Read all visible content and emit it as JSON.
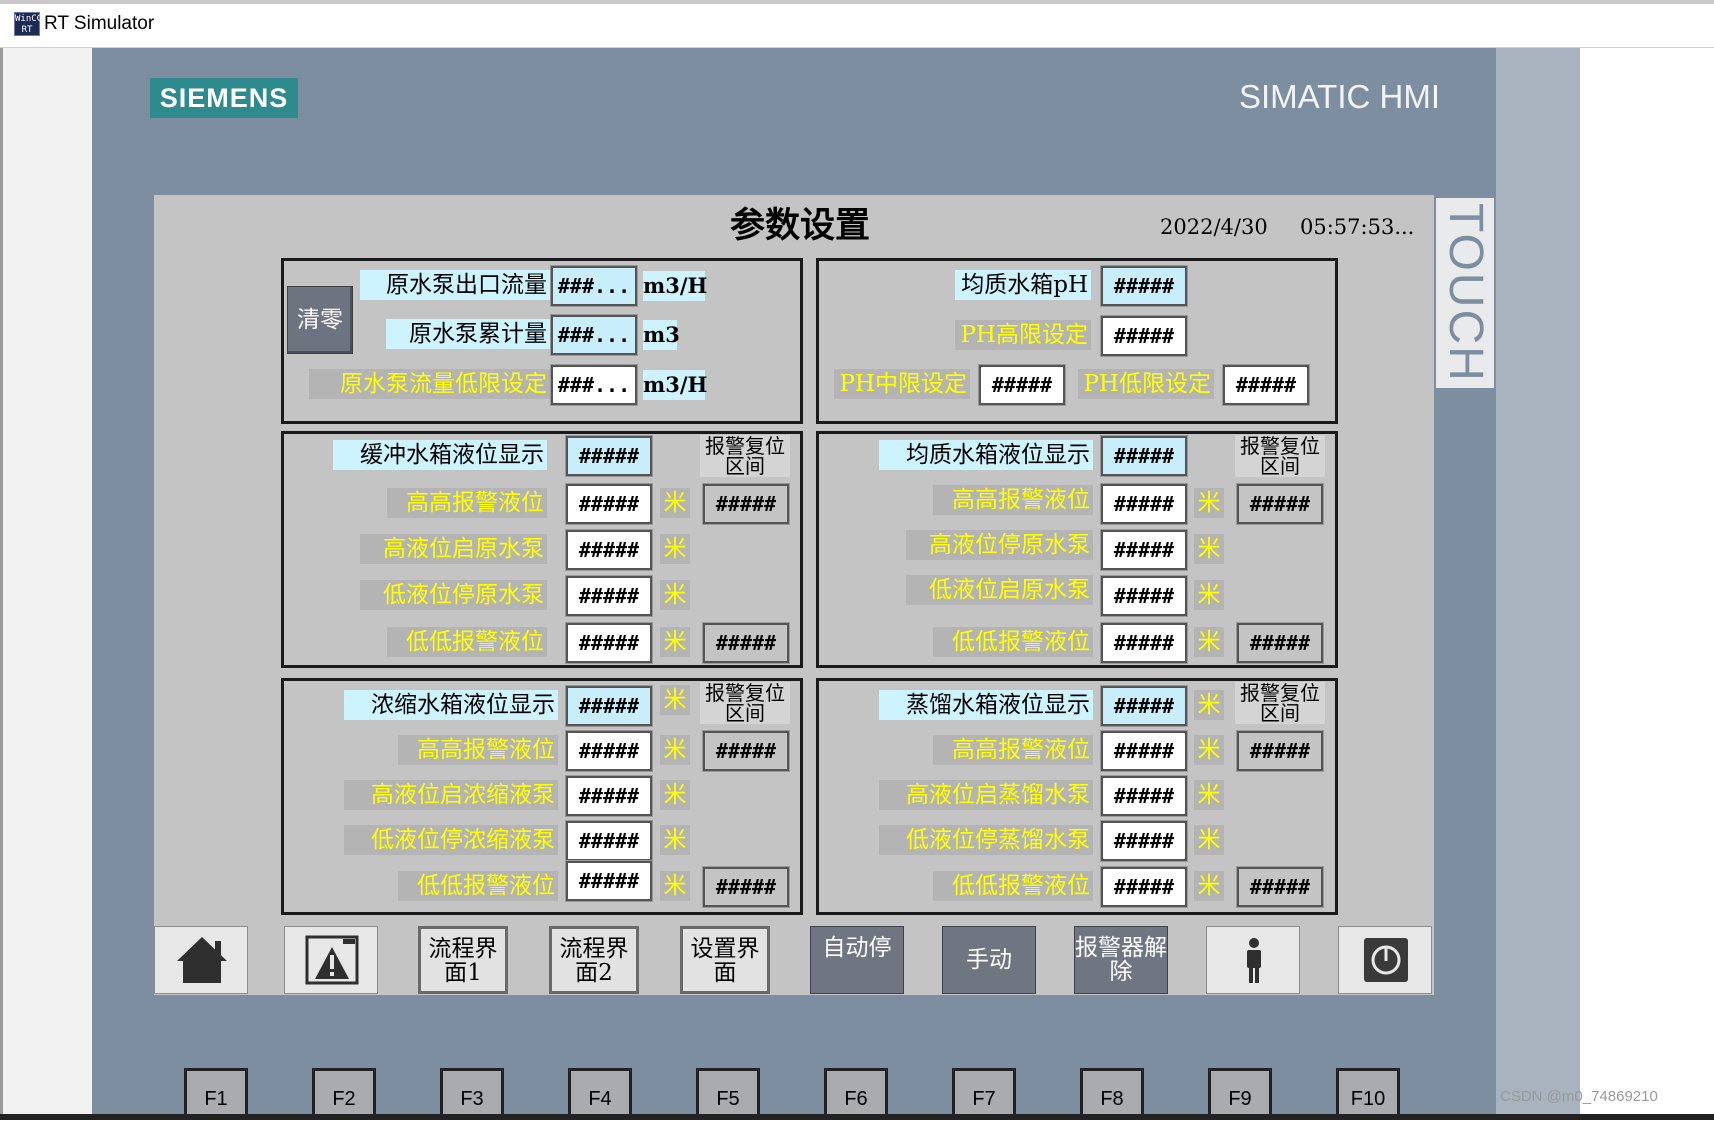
{
  "window": {
    "title": "RT Simulator",
    "icon_text": "WinCC RT"
  },
  "device": {
    "brand": "SIEMENS",
    "model": "SIMATIC HMI",
    "touch": "TOUCH"
  },
  "screen": {
    "title": "参数设置",
    "date": "2022/4/30",
    "time": "05:57:53..."
  },
  "flow_group": {
    "clear_button": "清零",
    "outlet_flow": {
      "label": "原水泵出口流量",
      "value": "###...",
      "unit": "m3/H"
    },
    "cumulative": {
      "label": "原水泵累计量",
      "value": "###...",
      "unit": "m3"
    },
    "flow_low_limit": {
      "label": "原水泵流量低限设定",
      "value": "###...",
      "unit": "m3/H"
    }
  },
  "ph_group": {
    "ph_display": {
      "label": "均质水箱pH",
      "value": "#####"
    },
    "ph_high": {
      "label": "PH高限设定",
      "value": "#####"
    },
    "ph_mid": {
      "label": "PH中限设定",
      "value": "#####"
    },
    "ph_low": {
      "label": "PH低限设定",
      "value": "#####"
    }
  },
  "common": {
    "unit_meter": "米",
    "alarm_reset_header": "报警复位区间"
  },
  "tanks": [
    {
      "display_label": "缓冲水箱液位显示",
      "display_value": "#####",
      "rows": [
        {
          "label": "高高报警液位",
          "value": "#####",
          "reset": "#####"
        },
        {
          "label": "高液位启原水泵",
          "value": "#####"
        },
        {
          "label": "低液位停原水泵",
          "value": "#####"
        },
        {
          "label": "低低报警液位",
          "value": "#####",
          "reset": "#####"
        }
      ]
    },
    {
      "display_label": "均质水箱液位显示",
      "display_value": "#####",
      "rows": [
        {
          "label": "高高报警液位",
          "value": "#####",
          "reset": "#####"
        },
        {
          "label": "高液位停原水泵",
          "value": "#####"
        },
        {
          "label": "低液位启原水泵",
          "value": "#####"
        },
        {
          "label": "低低报警液位",
          "value": "#####",
          "reset": "#####"
        }
      ]
    },
    {
      "display_label": "浓缩水箱液位显示",
      "display_value": "#####",
      "rows": [
        {
          "label": "高高报警液位",
          "value": "#####",
          "reset": "#####"
        },
        {
          "label": "高液位启浓缩液泵",
          "value": "#####"
        },
        {
          "label": "低液位停浓缩液泵",
          "value": "#####"
        },
        {
          "label": "低低报警液位",
          "value": "#####",
          "reset": "#####"
        }
      ]
    },
    {
      "display_label": "蒸馏水箱液位显示",
      "display_value": "#####",
      "rows": [
        {
          "label": "高高报警液位",
          "value": "#####",
          "reset": "#####"
        },
        {
          "label": "高液位启蒸馏水泵",
          "value": "#####"
        },
        {
          "label": "低液位停蒸馏水泵",
          "value": "#####"
        },
        {
          "label": "低低报警液位",
          "value": "#####",
          "reset": "#####"
        }
      ]
    }
  ],
  "nav": {
    "flow1": "流程界面1",
    "flow2": "流程界面2",
    "settings": "设置界面",
    "auto_stop": "自动停",
    "manual": "手动",
    "alarm_release": "报警器解除"
  },
  "fkeys": [
    "F1",
    "F2",
    "F3",
    "F4",
    "F5",
    "F6",
    "F7",
    "F8",
    "F9",
    "F10"
  ],
  "watermark": "CSDN @m0_74869210",
  "icons": {
    "home": "home-icon",
    "alarm": "warning-triangle-icon",
    "user": "user-icon",
    "power": "power-icon"
  }
}
